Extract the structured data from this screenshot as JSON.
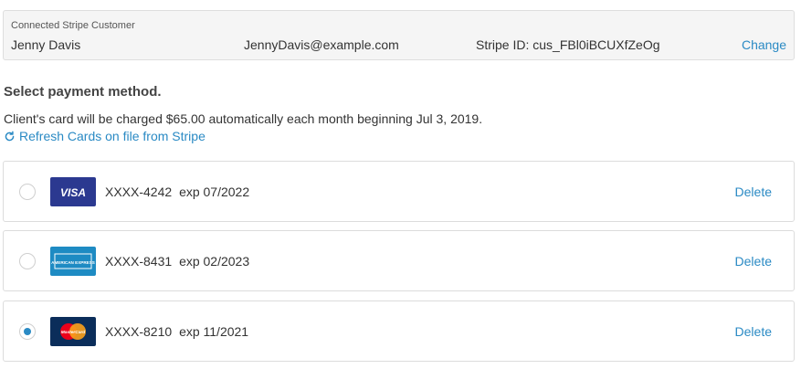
{
  "customer": {
    "label": "Connected Stripe Customer",
    "name": "Jenny Davis",
    "email": "JennyDavis@example.com",
    "stripe_id": "Stripe ID: cus_FBl0iBCUXfZeOg",
    "change_label": "Change"
  },
  "payment": {
    "title": "Select payment method.",
    "description": "Client's card will be charged $65.00 automatically each month beginning Jul 3, 2019.",
    "refresh_label": "Refresh Cards on file from Stripe"
  },
  "cards": [
    {
      "brand": "visa",
      "brand_text": "VISA",
      "number": "XXXX-4242",
      "exp": "exp 07/2022",
      "selected": false,
      "delete_label": "Delete"
    },
    {
      "brand": "amex",
      "brand_text": "AMERICAN EXPRESS",
      "number": "XXXX-8431",
      "exp": "exp 02/2023",
      "selected": false,
      "delete_label": "Delete"
    },
    {
      "brand": "mastercard",
      "brand_text": "MasterCard",
      "number": "XXXX-8210",
      "exp": "exp 11/2021",
      "selected": true,
      "delete_label": "Delete"
    }
  ],
  "colors": {
    "link": "#2a8ac4",
    "visa": "#2b3990",
    "amex": "#1e8bc3",
    "mastercard_bg": "#0b2d5a",
    "mastercard_red": "#eb001b",
    "mastercard_yellow": "#f79e1b"
  }
}
